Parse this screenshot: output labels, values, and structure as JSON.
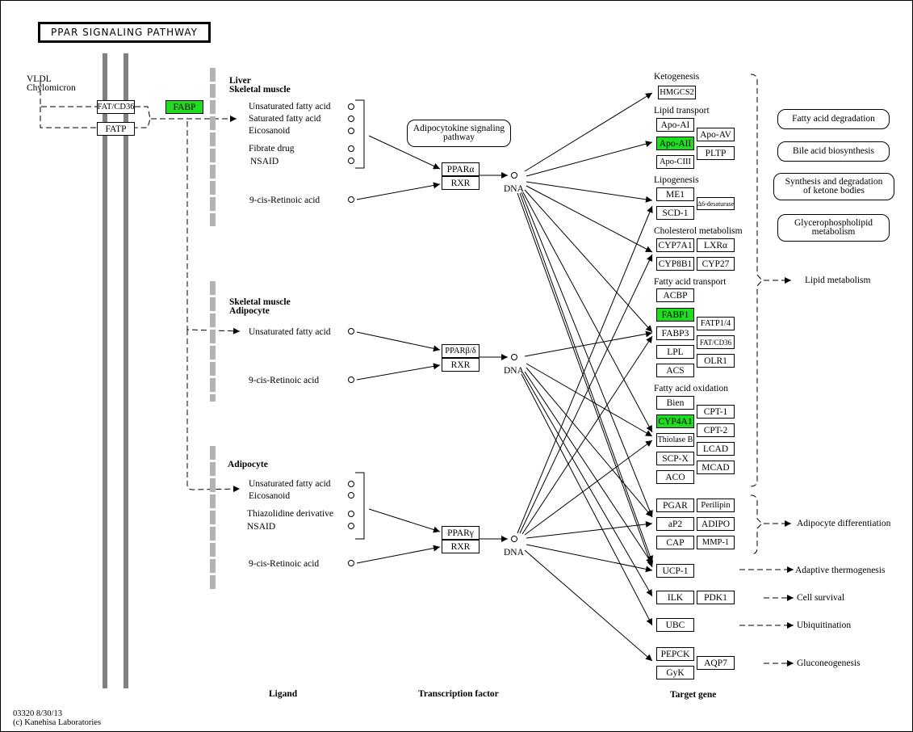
{
  "title": "PPAR SIGNALING PATHWAY",
  "left": {
    "source_label_1": "VLDL",
    "source_label_2": "Chylomicron",
    "genes": {
      "fatcd36": "FAT/CD36",
      "fatp": "FATP",
      "fabp": "FABP"
    }
  },
  "sections": {
    "alpha": {
      "tissue_1": "Liver",
      "tissue_2": "Skeletal muscle",
      "ligands": [
        "Unsaturated fatty acid",
        "Saturated fatty acid",
        "Eicosanoid",
        "Fibrate drug",
        "NSAID"
      ],
      "retinoic": "9-cis-Retinoic acid",
      "receptor": "PPARα",
      "partner": "RXR",
      "dna": "DNA"
    },
    "beta": {
      "tissue_1": "Skeletal muscle",
      "tissue_2": "Adipocyte",
      "ligands": [
        "Unsaturated fatty acid"
      ],
      "retinoic": "9-cis-Retinoic acid",
      "receptor": "PPARβ/δ",
      "partner": "RXR",
      "dna": "DNA"
    },
    "gamma": {
      "tissue_1": "Adipocyte",
      "ligands": [
        "Unsaturated fatty acid",
        "Eicosanoid",
        "Thiazolidine derivative",
        "NSAID"
      ],
      "retinoic": "9-cis-Retinoic acid",
      "receptor": "PPARγ",
      "partner": "RXR",
      "dna": "DNA"
    }
  },
  "adipocytokine_pathway": "Adipocytokine signaling pathway",
  "targets": {
    "ketogenesis": {
      "label": "Ketogenesis",
      "genes": [
        "HMGCS2"
      ]
    },
    "lipid_transport": {
      "label": "Lipid transport",
      "genes": [
        "Apo-AI",
        "Apo-AII",
        "Apo-CIII",
        "Apo-AV",
        "PLTP"
      ]
    },
    "lipogenesis": {
      "label": "Lipogenesis",
      "genes": [
        "ME1",
        "SCD-1",
        "Δ6-desaturase"
      ]
    },
    "cholesterol": {
      "label": "Cholesterol metabolism",
      "genes": [
        "CYP7A1",
        "LXRα",
        "CYP8B1",
        "CYP27"
      ]
    },
    "fa_transport": {
      "label": "Fatty acid transport",
      "genes": [
        "ACBP",
        "FABP1",
        "FABP3",
        "LPL",
        "ACS",
        "FATP1/4",
        "FAT/CD36",
        "OLR1"
      ]
    },
    "fa_oxidation": {
      "label": "Fatty acid oxidation",
      "genes": [
        "Bien",
        "CYP4A1",
        "Thiolase B",
        "SCP-X",
        "ACO",
        "CPT-1",
        "CPT-2",
        "LCAD",
        "MCAD"
      ]
    },
    "adipo": {
      "genes": [
        "PGAR",
        "aP2",
        "CAP",
        "Perilipin",
        "ADIPO",
        "MMP-1"
      ]
    },
    "others": {
      "ucp": "UCP-1",
      "ilk": "ILK",
      "pdk1": "PDK1",
      "ubc": "UBC",
      "pepck": "PEPCK",
      "gyk": "GyK",
      "aqp7": "AQP7"
    }
  },
  "highlighted_genes": [
    "FABP",
    "Apo-AII",
    "FABP1",
    "CYP4A1"
  ],
  "highlight_color": "#1fdc1f",
  "linked_pathways": [
    "Fatty acid degradation",
    "Bile acid biosynthesis",
    "Synthesis and degradation of ketone bodies",
    "Glycerophospholipid metabolism"
  ],
  "outcomes": {
    "lipid": "Lipid metabolism",
    "adipocyte": "Adipocyte differentiation",
    "thermo": "Adaptive thermogenesis",
    "survival": "Cell survival",
    "ubiq": "Ubiquitination",
    "gluco": "Gluconeogenesis"
  },
  "columns": {
    "ligand": "Ligand",
    "tf": "Transcription factor",
    "target": "Target gene"
  },
  "footer": {
    "id_date": "03320 8/30/13",
    "copyright": "(c) Kanehisa Laboratories"
  }
}
